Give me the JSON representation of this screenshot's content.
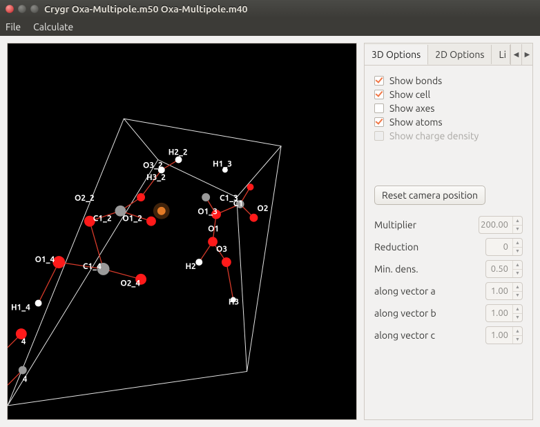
{
  "window": {
    "title": "Crygr Oxa-Multipole.m50 Oxa-Multipole.m40"
  },
  "menu": {
    "file": "File",
    "calculate": "Calculate"
  },
  "tabs": {
    "items": [
      "3D Options",
      "2D Options",
      "Lines"
    ],
    "truncated_visible": "Li"
  },
  "options3d": {
    "show_bonds": {
      "label": "Show bonds",
      "checked": true
    },
    "show_cell": {
      "label": "Show cell",
      "checked": true
    },
    "show_axes": {
      "label": "Show axes",
      "checked": false
    },
    "show_atoms": {
      "label": "Show atoms",
      "checked": true
    },
    "show_charge_density": {
      "label": "Show charge density",
      "checked": false,
      "disabled": true
    },
    "reset_camera": "Reset camera position",
    "multiplier": {
      "label": "Multiplier",
      "value": "200.00"
    },
    "reduction": {
      "label": "Reduction",
      "value": "0"
    },
    "min_dens": {
      "label": "Min. dens.",
      "value": "0.50"
    },
    "along_a": {
      "label": "along vector a",
      "value": "1.00"
    },
    "along_b": {
      "label": "along vector b",
      "value": "1.00"
    },
    "along_c": {
      "label": "along vector c",
      "value": "1.00"
    }
  },
  "viewport": {
    "atom_labels": [
      "O2_2",
      "H2_2",
      "O3_2",
      "H3_2",
      "C1_2",
      "O1_2",
      "H1_3",
      "C1_3",
      "O1_3",
      "C1",
      "O2",
      "O1",
      "O3",
      "H2",
      "O2_4",
      "O1_4",
      "C1_4",
      "H1_4",
      "H3",
      "4",
      "4"
    ]
  }
}
